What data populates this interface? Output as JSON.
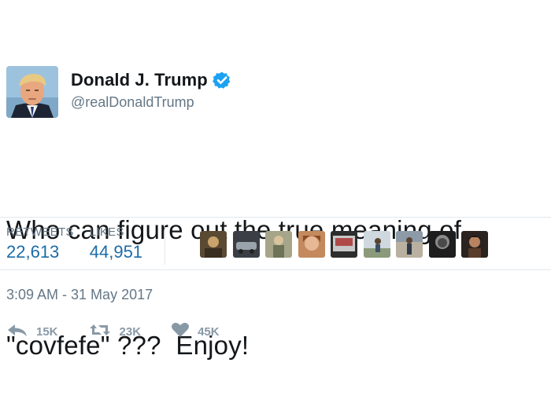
{
  "user": {
    "name": "Donald J. Trump",
    "handle": "@realDonaldTrump",
    "verified": true
  },
  "tweet": {
    "line1": "Who can figure out the true meaning of",
    "line2": "\"covfefe\" ???  Enjoy!"
  },
  "stats": {
    "retweets_label": "RETWEETS",
    "retweets_value": "22,613",
    "likes_label": "LIKES",
    "likes_value": "44,951"
  },
  "liker_avatar_count": 9,
  "timestamp": "3:09 AM - 31 May 2017",
  "actions": {
    "reply_count": "15K",
    "retweet_count": "23K",
    "like_count": "45K"
  },
  "colors": {
    "accent": "#1da1f2",
    "stat_value": "#1b6ca8",
    "muted": "#657786",
    "icon": "#8899a6"
  }
}
